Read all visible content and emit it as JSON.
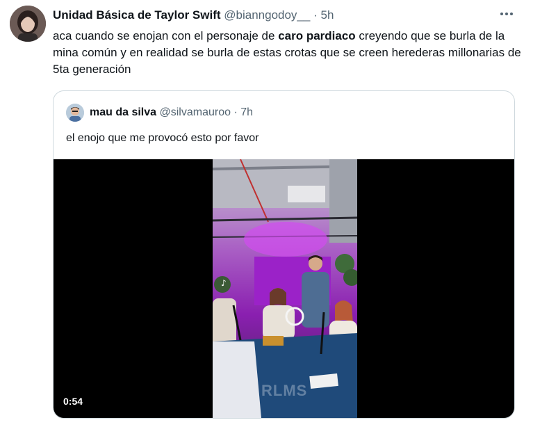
{
  "tweet": {
    "display_name": "Unidad Básica de Taylor Swift",
    "handle": "@bianngodoy__",
    "separator": "·",
    "time": "5h",
    "text_before": "aca cuando se enojan con el personaje de ",
    "text_bold": "caro pardiaco",
    "text_after": " creyendo que se burla de la mina común y en realidad se burla de estas crotas que se creen herederas millonarias de 5ta generación",
    "avatar_icon": "user-avatar-photo",
    "more_icon": "more-options-icon"
  },
  "quote": {
    "display_name": "mau da silva",
    "handle": "@silvamauroo",
    "separator": "·",
    "time": "7h",
    "text": "el enojo que me provocó esto por favor",
    "avatar_icon": "user-avatar-photo",
    "video": {
      "duration": "0:54",
      "watermark": "RLMS",
      "thumbnail_description_icon": "video-thumbnail"
    }
  },
  "colors": {
    "text_primary": "#0f1419",
    "text_secondary": "#536471",
    "border": "#cfd9de",
    "studio_purple": "#a020c8"
  }
}
